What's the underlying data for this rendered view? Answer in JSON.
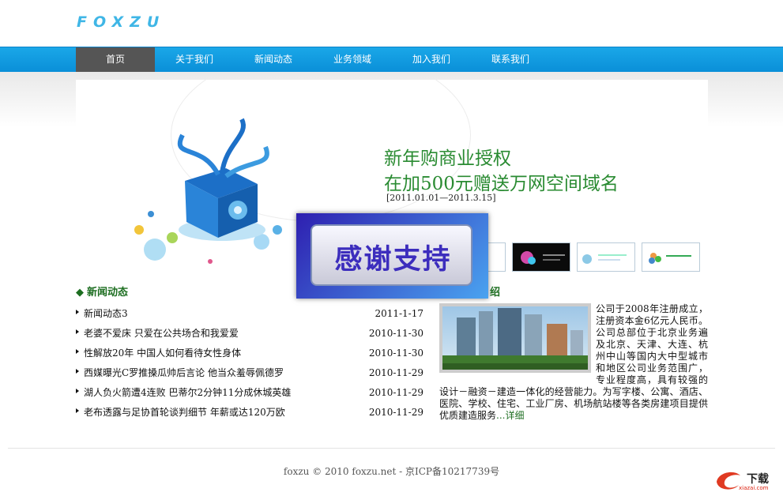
{
  "logo": {
    "text": "FOXZU"
  },
  "nav": {
    "items": [
      {
        "label": "首页"
      },
      {
        "label": "关于我们"
      },
      {
        "label": "新闻动态"
      },
      {
        "label": "业务领域"
      },
      {
        "label": "加入我们"
      },
      {
        "label": "联系我们"
      }
    ]
  },
  "banner": {
    "line1": "新年购商业授权",
    "line2": "在加500元赠送万网空间域名",
    "date": "[2011.01.01—2011.3.15]"
  },
  "overlay": {
    "text": "感谢支持"
  },
  "news": {
    "title": "新闻动态",
    "items": [
      {
        "title": "新闻动态3",
        "date": "2011-1-17"
      },
      {
        "title": "老婆不爱床 只爱在公共场合和我爱爱",
        "date": "2010-11-30"
      },
      {
        "title": "性解放20年 中国人如何看待女性身体",
        "date": "2010-11-30"
      },
      {
        "title": "西媒曝光C罗推搡瓜帅后言论 他当众羞辱佩德罗",
        "date": "2010-11-29"
      },
      {
        "title": "湖人负火箭遭4连败 巴蒂尔2分钟11分成休城英雄",
        "date": "2010-11-29"
      },
      {
        "title": "老布透露与足协首轮谈判细节 年薪或达120万欧",
        "date": "2010-11-29"
      }
    ]
  },
  "about": {
    "title_tail": "绍",
    "text": "公司于2008年注册成立，注册资本金6亿元人民币。公司总部位于北京业务遍及北京、天津、大连、杭州中山等国内大中型城市和地区公司业务范围广，专业程度高，具有较强的设计－融资－建造一体化的经营能力。为写字楼、公寓、酒店、医院、学校、住宅、工业厂房、机场航站楼等各类房建项目提供优质建造服务",
    "more": "...详细"
  },
  "footer": {
    "text": "foxzu   © 2010 foxzu.net - 京ICP备10217739号"
  },
  "watermark": {
    "text": "下载",
    "sub": "xiazai.com"
  }
}
